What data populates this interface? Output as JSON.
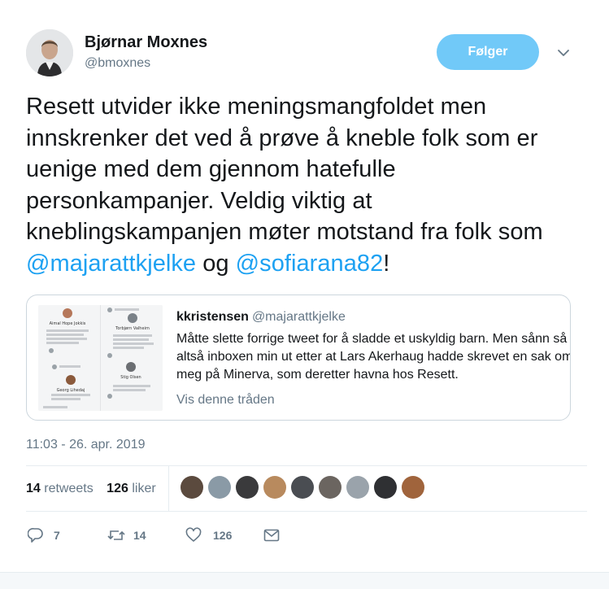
{
  "user": {
    "name": "Bjørnar Moxnes",
    "handle": "@bmoxnes",
    "follow_label": "Følger"
  },
  "tweet": {
    "text_parts": [
      "Resett utvider ikke meningsmangfoldet men innskrenker det ved å prøve å kneble folk som er uenige med dem gjennom hatefulle personkampanjer. Veldig viktig at kneblingskampanjen møter motstand fra folk som ",
      "@majarattkjelke",
      " og ",
      "@sofiarana82",
      "!"
    ],
    "timestamp": "11:03 - 26. apr. 2019"
  },
  "quote": {
    "name": "kkristensen",
    "handle": "@majarattkjelke",
    "text": "Måtte slette forrige tweet for å sladde et uskyldig barn. Men sånn så altså inboxen min ut etter at Lars Akerhaug hadde skrevet en sak om meg på Minerva, som deretter havna hos Resett.",
    "thread_link": "Vis denne tråden",
    "thumbnail": {
      "names": [
        "Aimal Hope Jokkis",
        "Torbjørn Valheim",
        "Georg Lihedaj",
        "Stig Olsen"
      ]
    }
  },
  "stats": {
    "retweets_count": "14",
    "retweets_label": "retweets",
    "likes_count": "126",
    "likes_label": "liker"
  },
  "actions": {
    "reply_count": "7",
    "retweet_count": "14",
    "like_count": "126"
  },
  "colors": {
    "accent": "#1da1f2",
    "follow_button": "#71c9f8",
    "muted_text": "#657786",
    "border": "#e6ecf0"
  }
}
